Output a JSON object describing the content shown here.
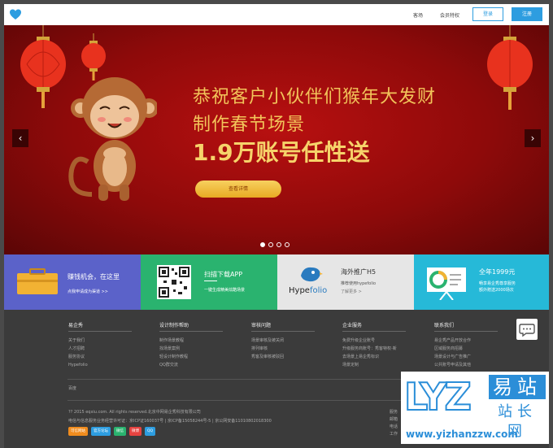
{
  "header": {
    "nav": [
      "客场",
      "会员特权"
    ],
    "login_label": "登录",
    "register_label": "注册"
  },
  "banner": {
    "line1": "恭祝客户小伙伴们猴年大发财",
    "line2": "制作春节场景",
    "line3": "1.9万账号任性送",
    "cta_label": "查看详情",
    "prev_label": "‹",
    "next_label": "›",
    "slides": 4,
    "active_slide": 1
  },
  "features": [
    {
      "title": "赚钱机会，在这里",
      "sub": "点我申请成为渠道 >>",
      "color": "#5b62c9"
    },
    {
      "title": "扫描下载APP",
      "sub": "一键生成精美炫酷场景",
      "color": "#2ab36f"
    },
    {
      "title": "海外推广H5",
      "sub": "推荐使用hypefolio",
      "sub2": "了解更多 >",
      "brand_a": "Hype",
      "brand_b": "folio",
      "color": "#e6e6e6"
    },
    {
      "title": "全年1999元",
      "sub": "畅享易企秀尊享服务",
      "sub2": "额外赠送2000场次",
      "color": "#26b9d8"
    }
  ],
  "footer": {
    "columns": [
      {
        "title": "易企秀",
        "items": [
          "关于我们",
          "人才招聘",
          "服务协议",
          "Hypefolio"
        ]
      },
      {
        "title": "设计制作帮助",
        "items": [
          "制作场景教程",
          "找场景案例",
          "轻设计制作教程",
          "QQ群交流"
        ]
      },
      {
        "title": "审核问题",
        "items": [
          "场景审核及被关闭",
          "排列审核",
          "秀客及审核被驳回"
        ]
      },
      {
        "title": "企业服务",
        "items": [
          "免费升级企业账号",
          "升级服务商账号：秀客特权-新",
          "去场景上易企秀标识",
          "场景定制"
        ]
      },
      {
        "title": "联系我们",
        "items": [
          "易企秀产品开放合作",
          "区域服务商招募",
          "场景设计与广告推广",
          "公共账号申请及其他"
        ]
      }
    ],
    "misc": "百度",
    "copyright": "?? 2015 eqxiu.com. All rights reserved.北京中网易企秀科技有限公司",
    "icp": "电信与信息服务业务经营许可证：京ICP证160037号 | 京ICP备15058244号-5 | 京公网安备11010802018300",
    "badges": [
      {
        "label": "可信网站",
        "color": "#f08c1e"
      },
      {
        "label": "官方论坛",
        "color": "#2d9de0"
      },
      {
        "label": "微信",
        "color": "#2ab36f"
      },
      {
        "label": "微博",
        "color": "#e64340"
      },
      {
        "label": "QQ",
        "color": "#2d9de0"
      }
    ],
    "right_info": [
      "服务",
      "邮箱",
      "电话",
      "工作"
    ]
  },
  "watermark": {
    "lyz": "LYZ",
    "cn1": "易站",
    "cn2": "站长网",
    "url": "www.yizhanzzw.com"
  }
}
